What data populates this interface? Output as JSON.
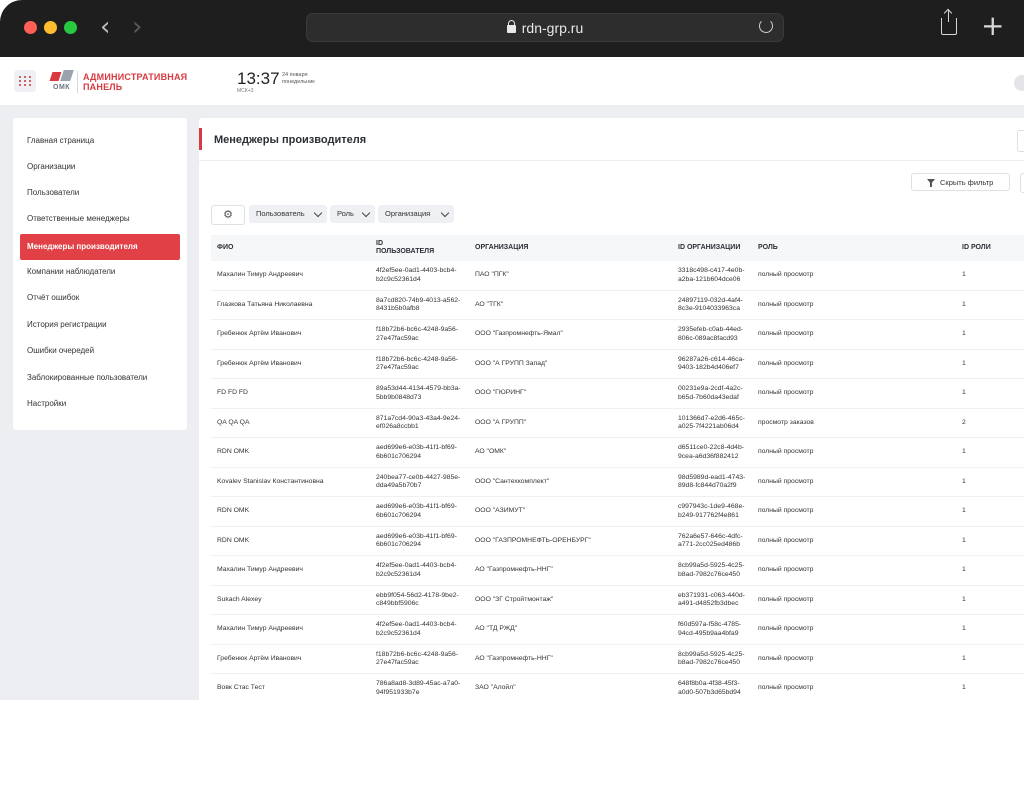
{
  "browser": {
    "url": "rdn-grp.ru"
  },
  "header": {
    "logo_small": "ОМК",
    "logo_title_line1": "АДМИНИСТРАТИВНАЯ",
    "logo_title_line2": "ПАНЕЛЬ",
    "time": "13:37",
    "timezone": "МСК+3",
    "date_line1": "24 января",
    "date_line2": "понедельник"
  },
  "sidebar": {
    "items": [
      {
        "label": "Главная страница"
      },
      {
        "label": "Организации"
      },
      {
        "label": "Пользователи"
      },
      {
        "label": "Ответственные менеджеры"
      },
      {
        "label": "Менеджеры производителя",
        "active": true
      },
      {
        "label": "Компании наблюдатели"
      },
      {
        "label": "Отчёт ошибок"
      },
      {
        "label": "История регистрации"
      },
      {
        "label": "Ошибки очередей"
      },
      {
        "label": "Заблокированные пользователи"
      },
      {
        "label": "Настройки"
      }
    ]
  },
  "main": {
    "title": "Менеджеры производителя",
    "hide_filter_label": "Скрыть фильтр",
    "filters": [
      {
        "label": "Пользователь"
      },
      {
        "label": "Роль"
      },
      {
        "label": "Организация"
      }
    ],
    "columns": {
      "fio": "ФИО",
      "user_id_1": "ID",
      "user_id_2": "ПОЛЬЗОВАТЕЛЯ",
      "org": "ОРГАНИЗАЦИЯ",
      "org_id": "ID ОРГАНИЗАЦИИ",
      "role": "РОЛЬ",
      "role_id": "ID РОЛИ"
    },
    "rows": [
      {
        "fio": "Махалин Тимур Андреевич",
        "id1": "4f2ef5ee-0ad1-4403-bcb4-",
        "id2": "b2c9c52361d4",
        "org": "ПАО \"ПГК\"",
        "orgid1": "3318c498-c417-4e0b-",
        "orgid2": "a2ba-121b604dce06",
        "role": "полный просмотр",
        "roleid": "1"
      },
      {
        "fio": "Глазкова Татьяна Николаевна",
        "id1": "8a7cd820-74b9-4013-a562-",
        "id2": "8431b5b0afb8",
        "org": "АО \"ТГК\"",
        "orgid1": "24897119-032d-4af4-",
        "orgid2": "8c3e-9104033963ca",
        "role": "полный просмотр",
        "roleid": "1"
      },
      {
        "fio": "Гребенюк Артём Иванович",
        "id1": "f18b72b6-bc6c-4248-9a56-",
        "id2": "27e47fac59ac",
        "org": "ООО \"Газпромнефть-Ямал\"",
        "orgid1": "2935efeb-c0ab-44ed-",
        "orgid2": "806c-089ac8facd93",
        "role": "полный просмотр",
        "roleid": "1"
      },
      {
        "fio": "Гребенюк Артём Иванович",
        "id1": "f18b72b6-bc6c-4248-9a56-",
        "id2": "27e47fac59ac",
        "org": "ООО \"А ГРУПП Запад\"",
        "orgid1": "96287a26-c614-46ca-",
        "orgid2": "9403-182b4d406ef7",
        "role": "полный просмотр",
        "roleid": "1"
      },
      {
        "fio": "FD FD FD",
        "id1": "89a53d44-4134-4579-bb3a-",
        "id2": "5bb9b0848d73",
        "org": "ООО \"ГЮРИНГ\"",
        "orgid1": "00231e9a-2cdf-4a2c-",
        "orgid2": "b65d-7b60da43edaf",
        "role": "полный просмотр",
        "roleid": "1"
      },
      {
        "fio": "QA QA QA",
        "id1": "871a7cd4-90a3-43a4-9e24-",
        "id2": "ef026a8ccbb1",
        "org": "ООО \"А ГРУПП\"",
        "orgid1": "101366d7-e2d6-465c-",
        "orgid2": "a025-7f4221ab06d4",
        "role": "просмотр заказов",
        "roleid": "2"
      },
      {
        "fio": "RDN OMK",
        "id1": "aed699e6-e03b-41f1-bf69-",
        "id2": "6b601c706294",
        "org": "АО \"ОМК\"",
        "orgid1": "d6511ce0-22c8-4d4b-",
        "orgid2": "9cea-a6d36f882412",
        "role": "полный просмотр",
        "roleid": "1"
      },
      {
        "fio": "Kovalev Stanislav Константиновна",
        "id1": "240bea77-ce0b-4427-985e-",
        "id2": "dda49a5b70b7",
        "org": "ООО \"Сантехкомплект\"",
        "orgid1": "98d5989d-ead1-4743-",
        "orgid2": "89d8-fc844d70a2f9",
        "role": "полный просмотр",
        "roleid": "1"
      },
      {
        "fio": "RDN OMK",
        "id1": "aed699e6-e03b-41f1-bf69-",
        "id2": "6b601c706294",
        "org": "ООО \"АЗИМУТ\"",
        "orgid1": "c997943c-1de9-468e-",
        "orgid2": "b249-917762f4e861",
        "role": "полный просмотр",
        "roleid": "1"
      },
      {
        "fio": "RDN OMK",
        "id1": "aed699e6-e03b-41f1-bf69-",
        "id2": "6b601c706294",
        "org": "ООО \"ГАЗПРОМНЕФТЬ-ОРЕНБУРГ\"",
        "orgid1": "762a6e57-646c-4dfc-",
        "orgid2": "a771-2cc025ed486b",
        "role": "полный просмотр",
        "roleid": "1"
      },
      {
        "fio": "Махалин Тимур Андреевич",
        "id1": "4f2ef5ee-0ad1-4403-bcb4-",
        "id2": "b2c9c52361d4",
        "org": "АО \"Газпромнефть-ННГ\"",
        "orgid1": "8cb99a5d-5925-4c25-",
        "orgid2": "b8ad-7982c76ce450",
        "role": "полный просмотр",
        "roleid": "1"
      },
      {
        "fio": "Sukach Alexey",
        "id1": "ebb9f054-56d2-4178-9be2-",
        "id2": "c849bbf5906c",
        "org": "ООО \"ЗГ Стройтмонтаж\"",
        "orgid1": "eb371931-c063-440d-",
        "orgid2": "a491-d4852fb3dbec",
        "role": "полный просмотр",
        "roleid": "1"
      },
      {
        "fio": "Махалин Тимур Андреевич",
        "id1": "4f2ef5ee-0ad1-4403-bcb4-",
        "id2": "b2c9c52361d4",
        "org": "АО \"ТД РЖД\"",
        "orgid1": "f60d597a-f58c-4785-",
        "orgid2": "94cd-495b9aa4bfa9",
        "role": "полный просмотр",
        "roleid": "1"
      },
      {
        "fio": "Гребенюк Артём Иванович",
        "id1": "f18b72b6-bc6c-4248-9a56-",
        "id2": "27e47fac59ac",
        "org": "АО \"Газпромнефть-ННГ\"",
        "orgid1": "8cb99a5d-5925-4c25-",
        "orgid2": "b8ad-7982c76ce450",
        "role": "полный просмотр",
        "roleid": "1"
      },
      {
        "fio": "Вовк Стас Тест",
        "id1": "786a8ad8-3d89-45ac-a7a0-",
        "id2": "94f951933b7e",
        "org": "ЗАО \"Алойл\"",
        "orgid1": "648f8b0a-4f38-45f3-",
        "orgid2": "a0d0-507b3d65bd94",
        "role": "полный просмотр",
        "roleid": "1"
      }
    ]
  },
  "colors": {
    "accent": "#e04046",
    "chrome": "#1e1e1e",
    "app_bg": "#eceef1"
  }
}
